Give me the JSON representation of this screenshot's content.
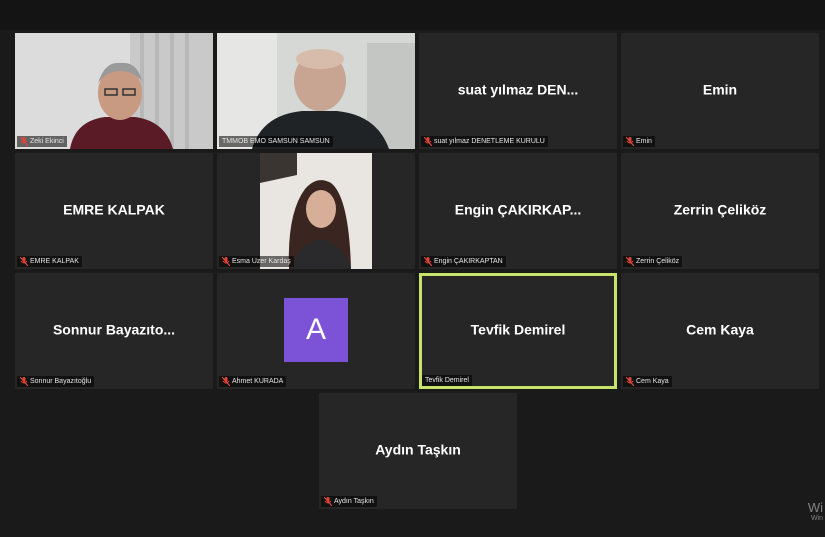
{
  "participants": [
    {
      "display_name": "",
      "label": "Zeki Ekinci",
      "video": "man-glasses-white-office",
      "muted": true
    },
    {
      "display_name": "",
      "label": "TMMOB EMO SAMSUN SAMSUN",
      "video": "bald-man-office",
      "muted": false
    },
    {
      "display_name": "suat yılmaz DEN...",
      "label": "suat yılmaz DENETLEME KURULU",
      "muted": true
    },
    {
      "display_name": "Emin",
      "label": "Emin",
      "muted": true
    },
    {
      "display_name": "EMRE KALPAK",
      "label": "EMRE KALPAK",
      "muted": true
    },
    {
      "display_name": "",
      "label": "Esma Uzer Kardaş",
      "video": "woman-long-hair",
      "muted": true
    },
    {
      "display_name": "Engin ÇAKIRKAP...",
      "label": "Engin ÇAKIRKAPTAN",
      "muted": true
    },
    {
      "display_name": "Zerrin Çeliköz",
      "label": "Zerrin Çeliköz",
      "muted": true
    },
    {
      "display_name": "Sonnur Bayazıto...",
      "label": "Sonnur Bayazıtoğlu",
      "muted": true
    },
    {
      "display_name": "",
      "label": "Ahmet KURADA",
      "avatar_letter": "A",
      "avatar_color": "#7c52d6",
      "muted": true
    },
    {
      "display_name": "Tevfik Demirel",
      "label": "Tevfik Demirel",
      "muted": false,
      "active_speaker": true
    },
    {
      "display_name": "Cem Kaya",
      "label": "Cem Kaya",
      "muted": true
    },
    {
      "display_name": "Aydın Taşkın",
      "label": "Aydın Taşkın",
      "muted": true
    }
  ],
  "colors": {
    "background": "#1a1a1a",
    "tile": "#262626",
    "active_border": "#c8e36a",
    "muted_icon": "#e0453a"
  },
  "watermark": {
    "line1": "Wi",
    "line2": "Win"
  }
}
